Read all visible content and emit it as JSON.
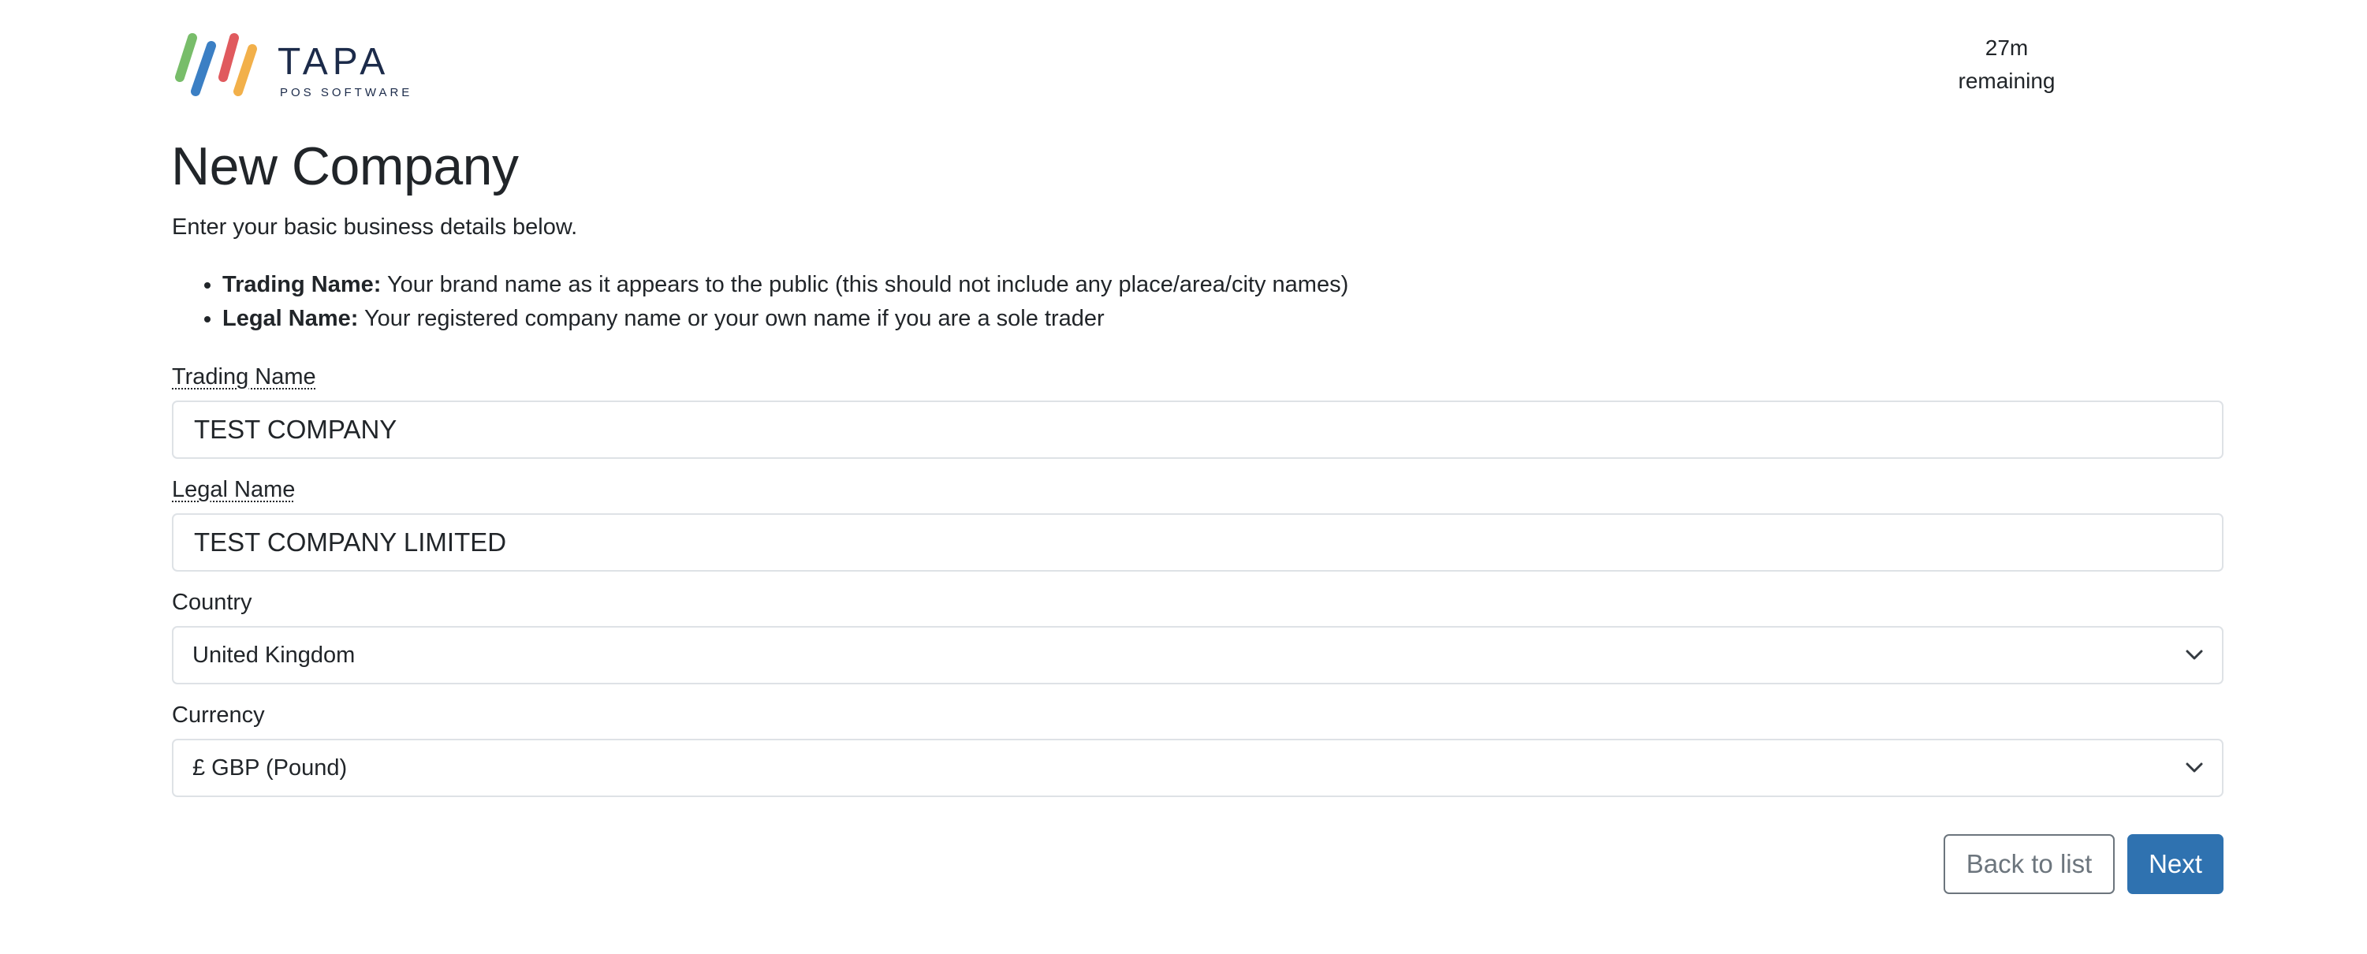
{
  "brand": {
    "name": "TAPA",
    "tagline": "POS SOFTWARE",
    "colors": {
      "stripe1": "#78bd6a",
      "stripe2": "#3b7fc4",
      "stripe3": "#e05a5e",
      "stripe4": "#f2b04a",
      "wordmark": "#1c2b4a"
    }
  },
  "timer": {
    "value": "27m",
    "label": "remaining"
  },
  "page": {
    "title": "New Company",
    "intro": "Enter your basic business details below.",
    "hints": [
      {
        "term": "Trading Name:",
        "description": " Your brand name as it appears to the public (this should not include any place/area/city names)"
      },
      {
        "term": "Legal Name:",
        "description": " Your registered company name or your own name if you are a sole trader"
      }
    ]
  },
  "form": {
    "trading_name": {
      "label": "Trading Name",
      "value": "TEST COMPANY"
    },
    "legal_name": {
      "label": "Legal Name",
      "value": "TEST COMPANY LIMITED"
    },
    "country": {
      "label": "Country",
      "selected": "United Kingdom"
    },
    "currency": {
      "label": "Currency",
      "selected": "£ GBP (Pound)"
    }
  },
  "actions": {
    "back_label": "Back to list",
    "next_label": "Next",
    "primary_color": "#2f72b0",
    "secondary_color": "#6c757d"
  }
}
